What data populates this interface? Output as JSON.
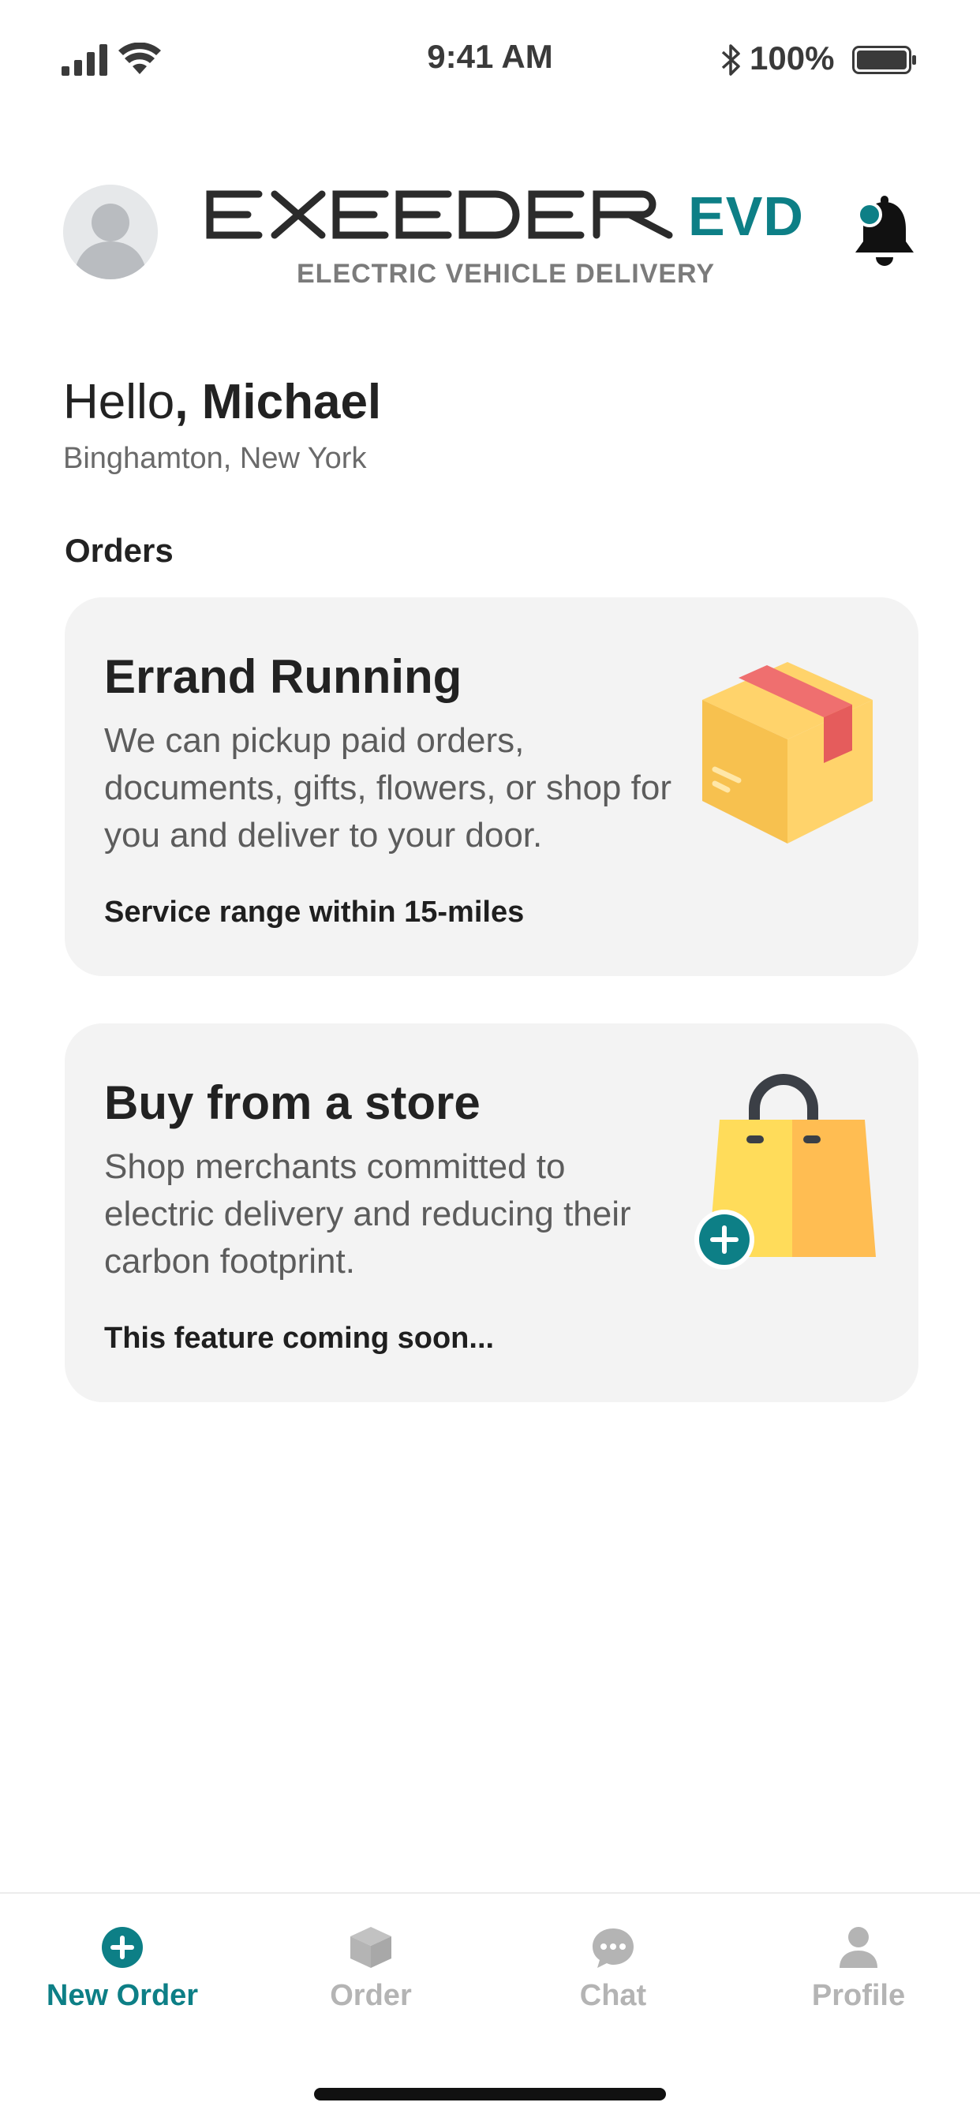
{
  "status_bar": {
    "time": "9:41 AM",
    "battery_percent": "100%",
    "icons": [
      "signal-icon",
      "wifi-icon",
      "bluetooth-icon",
      "battery-icon"
    ]
  },
  "header": {
    "logo_word": "EXEEDER",
    "logo_evd": "EVD",
    "logo_subtitle": "ELECTRIC VEHICLE DELIVERY",
    "avatar_icon": "user-avatar-icon",
    "notification_icon": "bell-icon"
  },
  "greeting": {
    "hello": "Hello",
    "name": ", Michael",
    "location": "Binghamton, New York"
  },
  "orders": {
    "section_title": "Orders",
    "cards": [
      {
        "title": "Errand Running",
        "description": "We can pickup paid orders, documents, gifts, flowers, or shop for you and deliver to your door.",
        "note": "Service range within 15-miles",
        "icon": "package-box-icon"
      },
      {
        "title": "Buy from a store",
        "description": "Shop merchants committed to electric delivery and reducing their carbon footprint.",
        "note": "This feature coming soon...",
        "icon": "shopping-bag-icon"
      }
    ]
  },
  "tabbar": {
    "tabs": [
      {
        "label": "New Order",
        "icon": "plus-circle-icon",
        "active": true
      },
      {
        "label": "Order",
        "icon": "box-icon",
        "active": false
      },
      {
        "label": "Chat",
        "icon": "chat-bubble-icon",
        "active": false
      },
      {
        "label": "Profile",
        "icon": "person-icon",
        "active": false
      }
    ]
  },
  "colors": {
    "accent": "#0d7f86",
    "card_background": "#f3f3f3",
    "inactive_tab": "#b4b4b4"
  }
}
